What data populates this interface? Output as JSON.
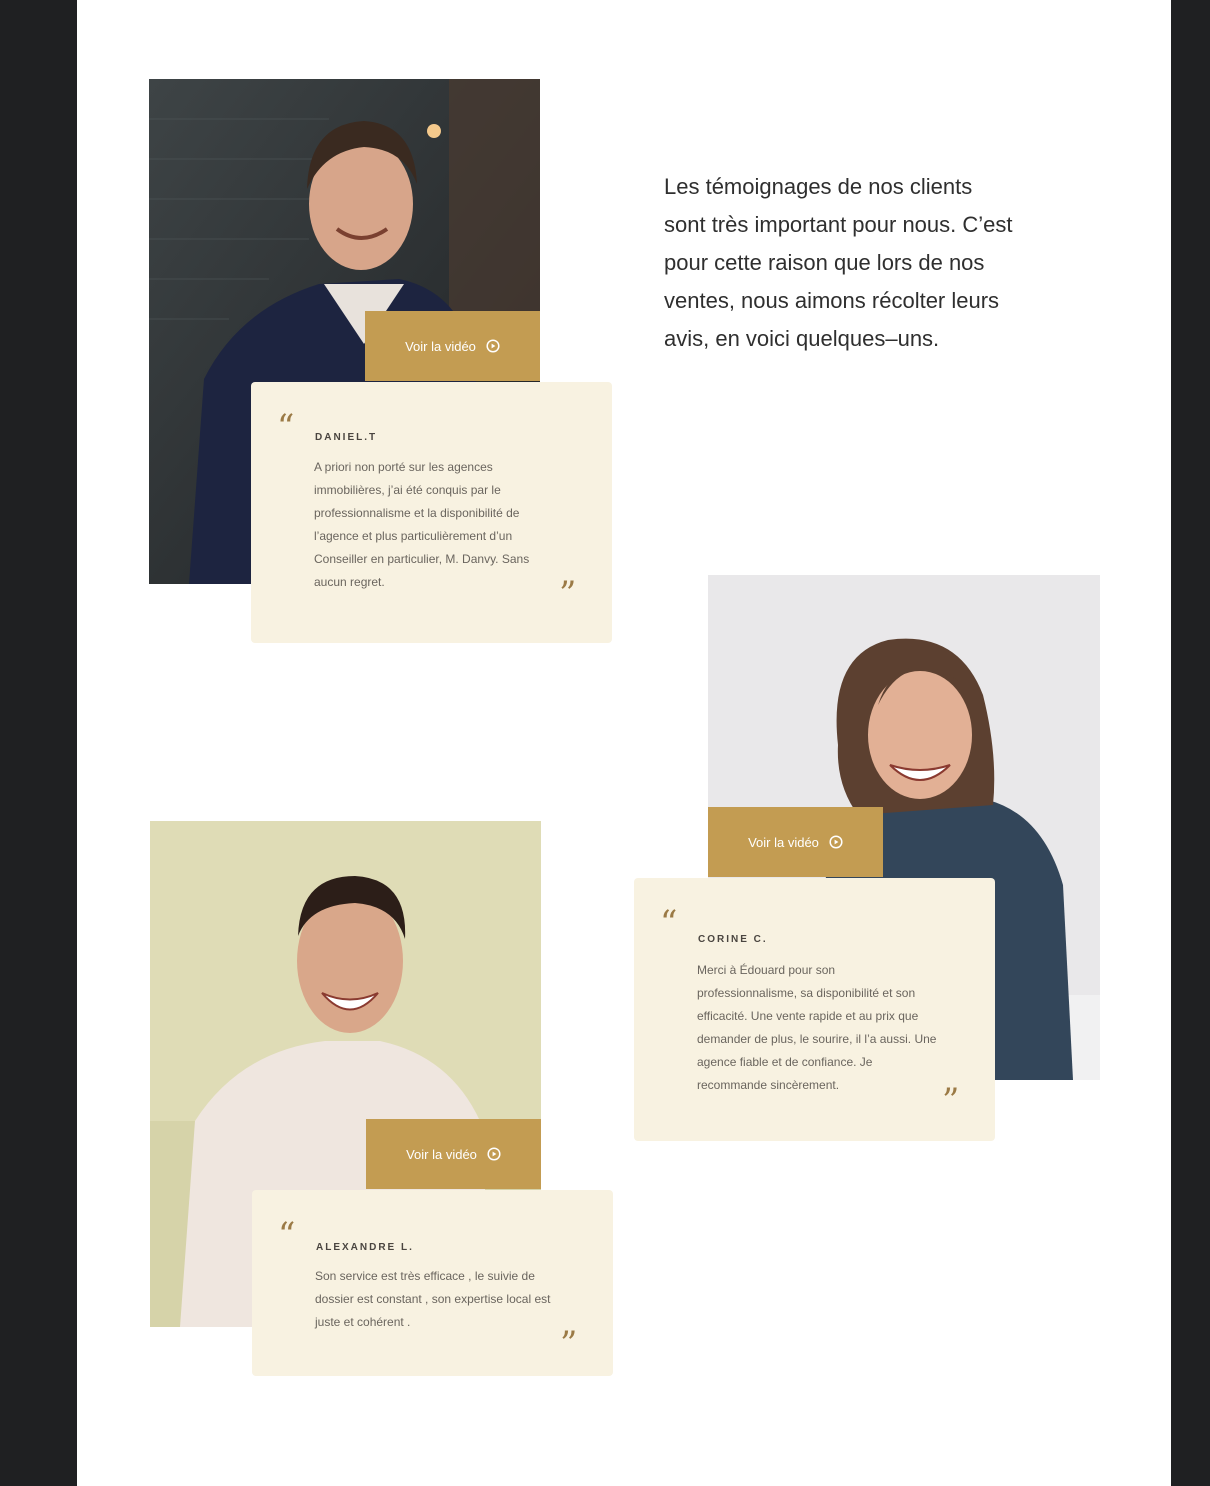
{
  "colors": {
    "frame": "#1f2022",
    "page_bg": "#ffffff",
    "accent_gold": "#c39c52",
    "card_bg": "#f8f2e1",
    "quote_mark": "#9b7a45"
  },
  "intro": {
    "text": "Les témoignages de nos clients sont très important pour nous. C’est pour cette raison que lors de nos ventes, nous aimons récolter leurs avis, en voici quelques–uns."
  },
  "testimonials": [
    {
      "author": "DANIEL.T",
      "text": "A priori non porté sur les agences immobilières, j’ai été conquis par le professionnalisme et la disponibilité de l’agence et plus particulièrement d’un Conseiller en particulier, M. Danvy. Sans aucun regret.",
      "video_label": "Voir la vidéo",
      "icon": "play-circle-icon"
    },
    {
      "author": "CORINE C.",
      "text": "Merci à Édouard pour son professionnalisme, sa disponibilité et son efficacité. Une vente rapide et au prix que demander de plus, le sourire, il l’a aussi. Une agence fiable et de confiance. Je recommande sincèrement.",
      "video_label": "Voir la vidéo",
      "icon": "play-circle-icon"
    },
    {
      "author": "ALEXANDRE L.",
      "text": "Son service est très efficace , le suivie de dossier est constant , son expertise local est juste et cohérent .",
      "video_label": "Voir la vidéo",
      "icon": "play-circle-icon"
    }
  ],
  "quote_marks": {
    "open": "“",
    "close": "”"
  }
}
